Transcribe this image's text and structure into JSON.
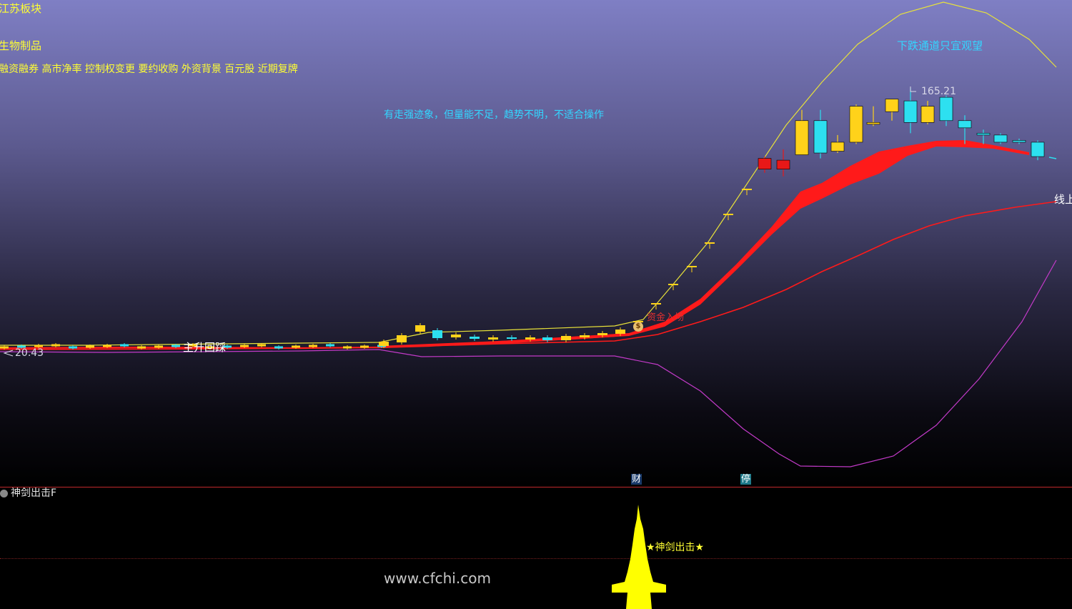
{
  "header": {
    "sector": "江苏板块",
    "industry": "生物制品",
    "concepts": "融资融券 高市净率 控制权变更 要约收购 外资背景 百元股 近期复牌"
  },
  "annotations": {
    "downtrend_note": "下跌通道只宜观望",
    "commentary": "有走强迹象，但量能不足，趋势不明，不适合操作",
    "low_price": "20.43",
    "high_price": "165.21",
    "pullback_label": "主升回踩",
    "capital_label": "资金入场",
    "capital_badge": "$",
    "line_label": "线上",
    "marker_cai": "财",
    "marker_ting": "停"
  },
  "indicator": {
    "name": "神剑出击F",
    "signal_label": "★神剑出击★"
  },
  "watermark": "www.cfchi.com",
  "colors": {
    "up": "#ffd21a",
    "down": "#2de0f0",
    "band_upper": "#e8e23a",
    "band_lower": "#c23ac8",
    "ma_red": "#ff1a1a",
    "signal": "#ffff00"
  },
  "chart_data": {
    "type": "candlestick",
    "price_extremes": {
      "low": 20.43,
      "high": 165.21
    },
    "recent_candles": [
      {
        "open": 70,
        "close": 78,
        "high": 80,
        "low": 70
      },
      {
        "open": 78,
        "close": 86,
        "high": 87,
        "low": 77
      },
      {
        "open": 86,
        "close": 94,
        "high": 95,
        "low": 85
      },
      {
        "open": 94,
        "close": 102,
        "high": 104,
        "low": 93
      },
      {
        "open": 102,
        "close": 113,
        "high": 115,
        "low": 102
      },
      {
        "open": 113,
        "close": 120,
        "high": 127,
        "low": 112
      },
      {
        "open": 120,
        "close": 126,
        "high": 127,
        "low": 118
      },
      {
        "open": 125,
        "close": 120,
        "high": 131,
        "low": 116
      },
      {
        "open": 128,
        "close": 147,
        "high": 153,
        "low": 128
      },
      {
        "open": 147,
        "close": 129,
        "high": 153,
        "low": 126
      },
      {
        "open": 130,
        "close": 135,
        "high": 139,
        "low": 129
      },
      {
        "open": 135,
        "close": 155,
        "high": 156,
        "low": 134
      },
      {
        "open": 145,
        "close": 146,
        "high": 155,
        "low": 144
      },
      {
        "open": 152,
        "close": 159,
        "high": 159,
        "low": 147
      },
      {
        "open": 158,
        "close": 146,
        "high": 165.21,
        "low": 140
      },
      {
        "open": 146,
        "close": 155,
        "high": 158,
        "low": 145
      },
      {
        "open": 160,
        "close": 147,
        "high": 161,
        "low": 144
      },
      {
        "open": 147,
        "close": 143,
        "high": 150,
        "low": 134
      },
      {
        "open": 140,
        "close": 139,
        "high": 142,
        "low": 134
      },
      {
        "open": 139,
        "close": 135,
        "high": 140,
        "low": 134
      },
      {
        "open": 136,
        "close": 135,
        "high": 137,
        "low": 134
      },
      {
        "open": 135,
        "close": 127,
        "high": 136,
        "low": 125
      }
    ],
    "title": "",
    "xlabel": "",
    "ylabel": ""
  }
}
